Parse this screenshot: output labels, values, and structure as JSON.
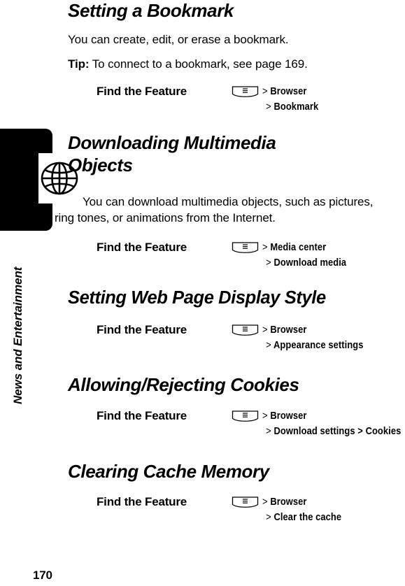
{
  "chapter": {
    "title": "News and Entertainment",
    "icon": "globe-icon"
  },
  "page_number": "170",
  "sections": [
    {
      "id": "setting-a-bookmark",
      "heading": "Setting a Bookmark",
      "paragraphs": [
        {
          "text": "You can create, edit, or erase a bookmark."
        }
      ],
      "tip": {
        "label": "Tip:",
        "text": " To connect to a bookmark, see page 169."
      },
      "find_the_feature": {
        "label": "Find the Feature",
        "icon": "menu-key-icon",
        "path_lines": [
          {
            "prefix": ">",
            "text": "Browser"
          },
          {
            "prefix": ">",
            "text": "Bookmark"
          }
        ]
      }
    },
    {
      "id": "downloading-multimedia-objects",
      "heading": "Downloading Multimedia Objects",
      "paragraphs": [
        {
          "text": "You can download multimedia objects, such as pictures, ring tones, or animations from the Internet."
        }
      ],
      "find_the_feature": {
        "label": "Find the Feature",
        "icon": "menu-key-icon",
        "path_lines": [
          {
            "prefix": ">",
            "text": "Media center"
          },
          {
            "prefix": ">",
            "text": "Download media"
          }
        ]
      }
    },
    {
      "id": "setting-web-page-display-style",
      "heading": "Setting Web Page Display Style",
      "find_the_feature": {
        "label": "Find the Feature",
        "icon": "menu-key-icon",
        "path_lines": [
          {
            "prefix": ">",
            "text": "Browser"
          },
          {
            "prefix": ">",
            "text": "Appearance settings"
          }
        ]
      }
    },
    {
      "id": "allowing-rejecting-cookies",
      "heading": "Allowing/Rejecting Cookies",
      "find_the_feature": {
        "label": "Find the Feature",
        "icon": "menu-key-icon",
        "path_lines": [
          {
            "prefix": ">",
            "text": "Browser"
          },
          {
            "prefix": ">",
            "text": "Download settings >  Cookies"
          }
        ]
      }
    },
    {
      "id": "clearing-cache-memory",
      "heading": "Clearing Cache Memory",
      "find_the_feature": {
        "label": "Find the Feature",
        "icon": "menu-key-icon",
        "path_lines": [
          {
            "prefix": ">",
            "text": "Browser"
          },
          {
            "prefix": ">",
            "text": "Clear the cache"
          }
        ]
      }
    }
  ]
}
